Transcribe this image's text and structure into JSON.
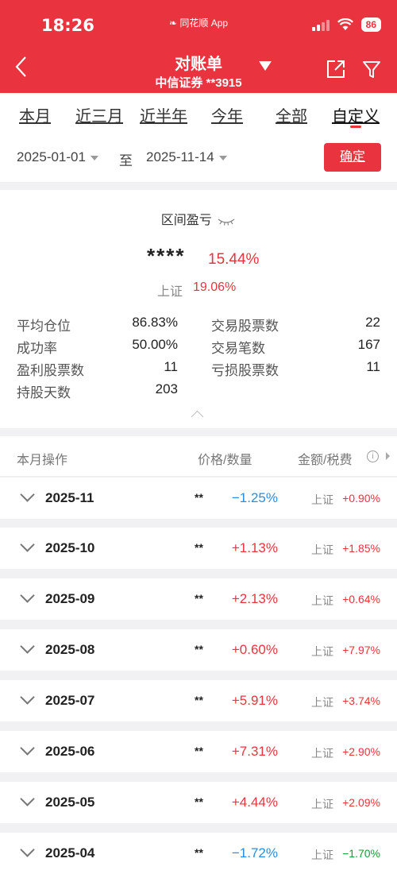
{
  "status_bar": {
    "time": "18:26",
    "app_label": "同花顺 App",
    "battery": "86"
  },
  "nav": {
    "title": "对账单",
    "subtitle": "中信证券 **3915"
  },
  "tabs": [
    "本月",
    "近三月",
    "近半年",
    "今年",
    "全部",
    "自定义"
  ],
  "active_tab": "自定义",
  "date_range": {
    "start": "2025-01-01",
    "separator": "至",
    "end": "2025-11-14",
    "confirm_label": "确定"
  },
  "summary": {
    "title": "区间盈亏",
    "masked_amount": "****",
    "return_pct": "15.44%",
    "index_label": "上证",
    "index_pct": "19.06%",
    "stats": {
      "avg_position_label": "平均仓位",
      "avg_position": "86.83%",
      "success_rate_label": "成功率",
      "success_rate": "50.00%",
      "profit_stocks_label": "盈利股票数",
      "profit_stocks": "11",
      "holding_days_label": "持股天数",
      "holding_days": "203",
      "traded_stocks_label": "交易股票数",
      "traded_stocks": "22",
      "trades_label": "交易笔数",
      "trades": "167",
      "loss_stocks_label": "亏损股票数",
      "loss_stocks": "11"
    }
  },
  "list_header": {
    "col1": "本月操作",
    "col2": "价格/数量",
    "col3": "金额/税费"
  },
  "months": [
    {
      "month": "2025-11",
      "masked": "**",
      "ret": "−1.25%",
      "bm_label": "上证",
      "bm": "+0.90%"
    },
    {
      "month": "2025-10",
      "masked": "**",
      "ret": "+1.13%",
      "bm_label": "上证",
      "bm": "+1.85%"
    },
    {
      "month": "2025-09",
      "masked": "**",
      "ret": "+2.13%",
      "bm_label": "上证",
      "bm": "+0.64%"
    },
    {
      "month": "2025-08",
      "masked": "**",
      "ret": "+0.60%",
      "bm_label": "上证",
      "bm": "+7.97%"
    },
    {
      "month": "2025-07",
      "masked": "**",
      "ret": "+5.91%",
      "bm_label": "上证",
      "bm": "+3.74%"
    },
    {
      "month": "2025-06",
      "masked": "**",
      "ret": "+7.31%",
      "bm_label": "上证",
      "bm": "+2.90%"
    },
    {
      "month": "2025-05",
      "masked": "**",
      "ret": "+4.44%",
      "bm_label": "上证",
      "bm": "+2.09%"
    },
    {
      "month": "2025-04",
      "masked": "**",
      "ret": "−1.72%",
      "bm_label": "上证",
      "bm": "−1.70%"
    }
  ],
  "colors": {
    "brand_red": "#e9343f",
    "loss_blue": "#2a8de0",
    "loss_green": "#1a9a3a"
  }
}
